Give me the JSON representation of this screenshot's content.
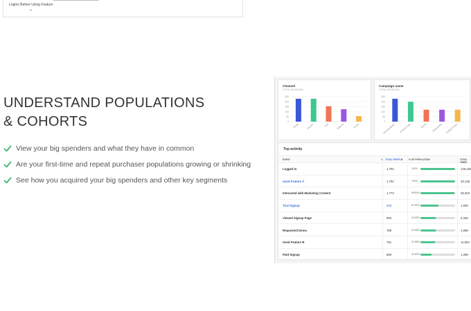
{
  "top_fragment": {
    "label": "Logins Before Using Feature",
    "sublabel": "A"
  },
  "hero": {
    "title": "UNDERSTAND POPULATIONS & COHORTS",
    "bullets": [
      "View your big spenders and what they have in common",
      "Are your first-time and repeat purchaser populations growing or shrinking",
      "See how you acquired your big spenders and other key segments"
    ],
    "check_color": "#3cb371"
  },
  "chart_data": [
    {
      "type": "bar",
      "title": "Channel",
      "subtitle": "TOTAL SESSIONS",
      "categories": [
        "Email",
        "Organic",
        "Paid",
        "Referral",
        "Social"
      ],
      "values": [
        230,
        230,
        155,
        125,
        55
      ],
      "colors": [
        "#3a57d8",
        "#3cc88e",
        "#f07356",
        "#9c58e0",
        "#f5b646"
      ],
      "ylim": [
        0,
        250
      ],
      "yticks": [
        "250",
        "200",
        "150",
        "100",
        "50",
        "0"
      ],
      "grid": true
    },
    {
      "type": "bar",
      "title": "Campaign name",
      "subtitle": "TOTAL SESSIONS",
      "categories": [
        "July Newsletter",
        "Summer Sale",
        "Brand",
        "Retargeting",
        "Holiday Promo"
      ],
      "values": [
        230,
        200,
        120,
        120,
        120
      ],
      "colors": [
        "#3a57d8",
        "#3cc88e",
        "#f07356",
        "#9c58e0",
        "#f5b646"
      ],
      "ylim": [
        0,
        250
      ],
      "yticks": [
        "250",
        "200",
        "150",
        "100",
        "50",
        "0"
      ],
      "grid": true
    }
  ],
  "table": {
    "title": "Top activity",
    "headers": {
      "event": "EVENT",
      "people": "TOTAL PEOPLE",
      "population": "% OF POPULATION",
      "times": "TOTAL TIMES"
    },
    "rows": [
      {
        "event": "Logged In",
        "people": "1,794",
        "pct": "100%",
        "fill": 1.0,
        "times": "135,328",
        "link": false
      },
      {
        "event": "Used Feature A",
        "people": "1,794",
        "pct": "100%",
        "fill": 1.0,
        "times": "48,148",
        "link": true
      },
      {
        "event": "Interacted with Marketing Content",
        "people": "1,773",
        "pct": "98.84%",
        "fill": 0.988,
        "times": "28,303",
        "link": false
      },
      {
        "event": "Trial Signup",
        "people": "938",
        "pct": "52.81%",
        "fill": 0.528,
        "times": "1,848",
        "link": true
      },
      {
        "event": "Viewed Signup Page",
        "people": "800",
        "pct": "44.59%",
        "fill": 0.446,
        "times": "6,325",
        "link": false
      },
      {
        "event": "Requested Demo",
        "people": "788",
        "pct": "43.85%",
        "fill": 0.438,
        "times": "1,868",
        "link": false
      },
      {
        "event": "Used Feature B",
        "people": "751",
        "pct": "41.86%",
        "fill": 0.419,
        "times": "11,054",
        "link": false
      },
      {
        "event": "Paid Signup",
        "people": "589",
        "pct": "32.83%",
        "fill": 0.328,
        "times": "1,298",
        "link": false
      }
    ]
  }
}
